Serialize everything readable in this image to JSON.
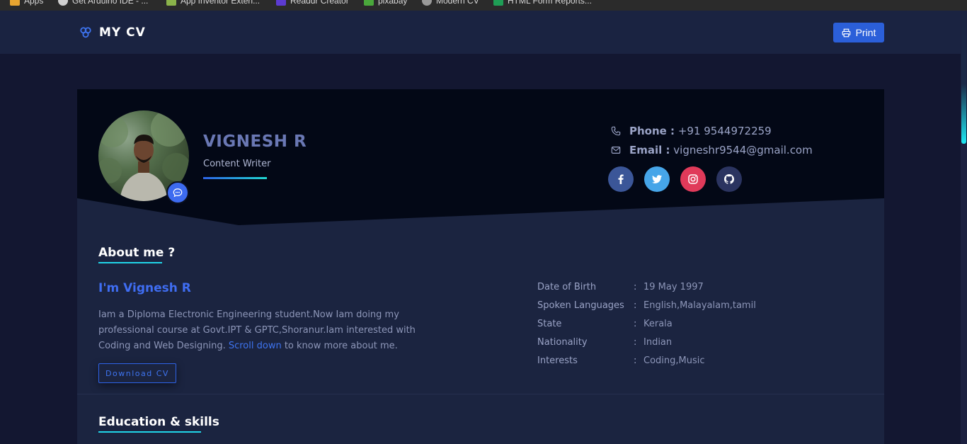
{
  "browser": {
    "bookmarks": [
      {
        "label": "Apps",
        "color": "#e8a530"
      },
      {
        "label": "Get Arduino IDE - ...",
        "color": "#cfcfcf"
      },
      {
        "label": "App Inventor Exten...",
        "color": "#8bb34a"
      },
      {
        "label": "Readdr Creator",
        "color": "#5c3bd1"
      },
      {
        "label": "pixabay",
        "color": "#4aa83b"
      },
      {
        "label": "Modern CV",
        "color": "#9a9a9a"
      },
      {
        "label": "HTML Form Reports...",
        "color": "#1f9d55"
      }
    ]
  },
  "navbar": {
    "brand": "MY CV",
    "brand_icon": "triple-circle-icon",
    "print_label": "Print",
    "print_icon": "printer-icon"
  },
  "profile": {
    "name": "VIGNESH R",
    "role": "Content Writer",
    "phone_label": "Phone :",
    "phone": "+91 9544972259",
    "email_label": "Email :",
    "email": "vigneshr9544@gmail.com",
    "socials": [
      "facebook-icon",
      "twitter-icon",
      "instagram-icon",
      "github-icon"
    ]
  },
  "about": {
    "title": "About me ?",
    "heading": "I'm Vignesh R",
    "text_before_link": "Iam a Diploma Electronic Engineering student.Now Iam doing my professional course at Govt.IPT & GPTC,Shoranur.Iam interested with Coding and Web Designing. ",
    "link": "Scroll down",
    "text_after_link": " to know more about me.",
    "download_label": "Download CV",
    "details": [
      {
        "key": "Date of Birth",
        "value": "19 May 1997"
      },
      {
        "key": "Spoken Languages",
        "value": "English,Malayalam,tamil"
      },
      {
        "key": "State",
        "value": "Kerala"
      },
      {
        "key": "Nationality",
        "value": "Indian"
      },
      {
        "key": "Interests",
        "value": "Coding,Music"
      }
    ]
  },
  "education": {
    "title": "Education & skills"
  },
  "colors": {
    "accent": "#3e74f0",
    "cyan": "#21d5e8",
    "background": "#131731",
    "card": "#1b2440"
  }
}
